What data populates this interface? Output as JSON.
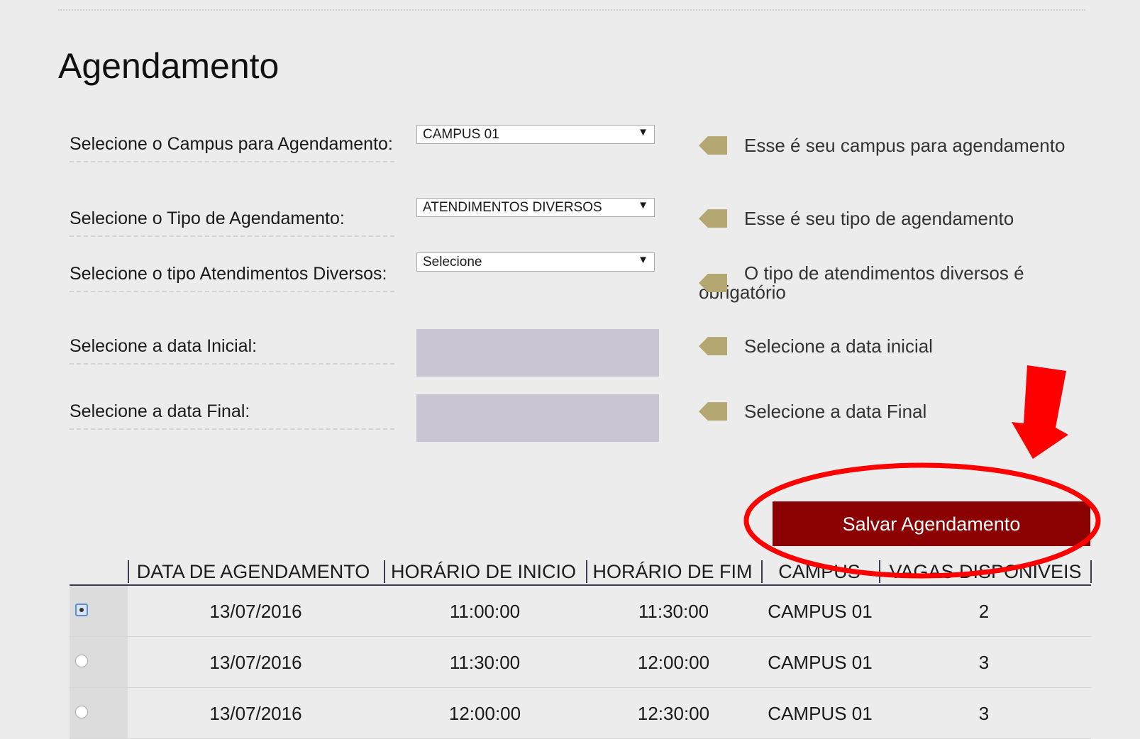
{
  "page": {
    "title": "Agendamento"
  },
  "form": {
    "campus_label": "Selecione o Campus para Agendamento:",
    "campus_value": "CAMPUS 01",
    "campus_hint": "Esse é seu campus para agendamento",
    "tipo_label": "Selecione o Tipo de Agendamento:",
    "tipo_value": "ATENDIMENTOS DIVERSOS",
    "tipo_hint": "Esse é seu tipo de agendamento",
    "diversos_label": "Selecione o tipo Atendimentos Diversos:",
    "diversos_value": "Selecione",
    "diversos_hint": "O tipo de atendimentos diversos é obrigatório",
    "data_inicial_label": "Selecione a data Inicial:",
    "data_inicial_hint": "Selecione a data inicial",
    "data_final_label": "Selecione a data Final:",
    "data_final_hint": "Selecione a data Final",
    "dropdown_arrow": "▼"
  },
  "actions": {
    "save_label": "Salvar Agendamento"
  },
  "annotation": {
    "color": "#ff0000"
  },
  "table": {
    "headers": [
      "DATA DE AGENDAMENTO",
      "HORÁRIO DE INICIO",
      "HORÁRIO DE FIM",
      "CAMPUS",
      "VAGAS DISPONIVEIS"
    ],
    "rows": [
      {
        "selected": true,
        "data": "13/07/2016",
        "inicio": "11:00:00",
        "fim": "11:30:00",
        "campus": "CAMPUS 01",
        "vagas": "2"
      },
      {
        "selected": false,
        "data": "13/07/2016",
        "inicio": "11:30:00",
        "fim": "12:00:00",
        "campus": "CAMPUS 01",
        "vagas": "3"
      },
      {
        "selected": false,
        "data": "13/07/2016",
        "inicio": "12:00:00",
        "fim": "12:30:00",
        "campus": "CAMPUS 01",
        "vagas": "3"
      }
    ]
  },
  "colors": {
    "button": "#8b0000",
    "marker": "#b5a771",
    "date_input": "#c9c4d1"
  }
}
